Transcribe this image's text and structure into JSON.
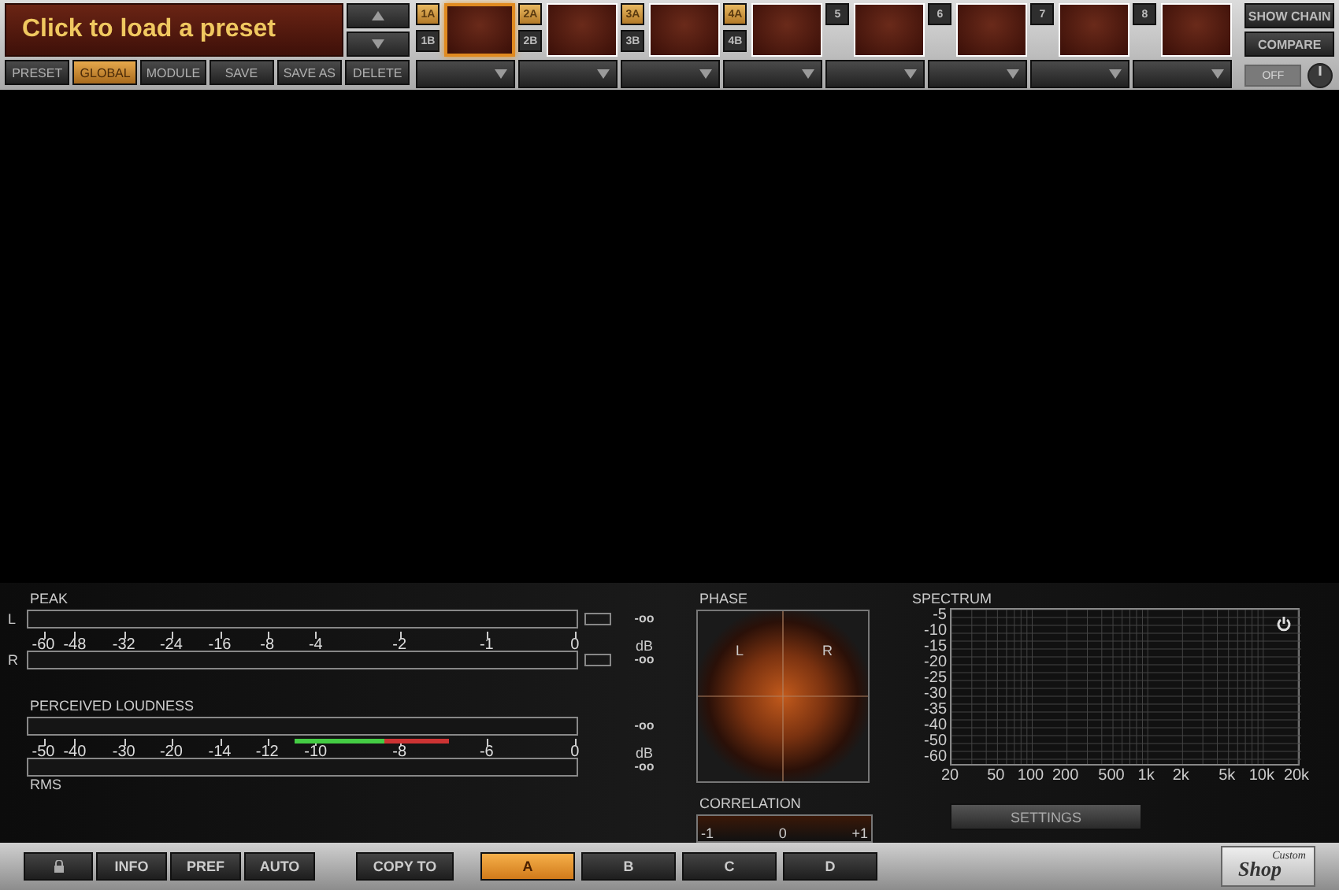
{
  "preset_bar": {
    "display": "Click to load a preset",
    "buttons": [
      {
        "label": "PRESET",
        "selected": false
      },
      {
        "label": "GLOBAL",
        "selected": true
      },
      {
        "label": "MODULE",
        "selected": false
      },
      {
        "label": "SAVE",
        "selected": false
      },
      {
        "label": "SAVE AS",
        "selected": false
      },
      {
        "label": "DELETE",
        "selected": false
      }
    ]
  },
  "slots": [
    {
      "active": true,
      "tabs": [
        {
          "label": "1A",
          "selected": true
        },
        {
          "label": "1B",
          "selected": false
        }
      ]
    },
    {
      "active": false,
      "tabs": [
        {
          "label": "2A",
          "selected": true
        },
        {
          "label": "2B",
          "selected": false
        }
      ]
    },
    {
      "active": false,
      "tabs": [
        {
          "label": "3A",
          "selected": true
        },
        {
          "label": "3B",
          "selected": false
        }
      ]
    },
    {
      "active": false,
      "tabs": [
        {
          "label": "4A",
          "selected": true
        },
        {
          "label": "4B",
          "selected": false
        }
      ]
    },
    {
      "active": false,
      "tabs": [
        {
          "label": "5",
          "selected": false
        }
      ]
    },
    {
      "active": false,
      "tabs": [
        {
          "label": "6",
          "selected": false
        }
      ]
    },
    {
      "active": false,
      "tabs": [
        {
          "label": "7",
          "selected": false
        }
      ]
    },
    {
      "active": false,
      "tabs": [
        {
          "label": "8",
          "selected": false
        }
      ]
    }
  ],
  "right_buttons": [
    "SHOW CHAIN",
    "COMPARE"
  ],
  "bypass": {
    "label": "OFF"
  },
  "peak": {
    "title": "PEAK",
    "channels": [
      {
        "name": "L",
        "reading": "-oo"
      },
      {
        "name": "R",
        "reading": "-oo"
      }
    ],
    "scale": [
      "-60",
      "-48",
      "-32",
      "-24",
      "-16",
      "-8",
      "-4",
      "-2",
      "-1",
      "0"
    ],
    "unit": "dB"
  },
  "loudness": {
    "title": "PERCEIVED LOUDNESS",
    "reading": "-oo",
    "scale": [
      "-50",
      "-40",
      "-30",
      "-20",
      "-14",
      "-12",
      "-10",
      "-8",
      "-6",
      "0"
    ],
    "unit": "dB",
    "rms_reading": "-oo",
    "rms_label": "RMS"
  },
  "phase": {
    "title": "PHASE",
    "left": "L",
    "right": "R"
  },
  "correlation": {
    "title": "CORRELATION",
    "labels": [
      "-1",
      "0",
      "+1"
    ]
  },
  "spectrum": {
    "title": "SPECTRUM",
    "y_labels": [
      "-5",
      "-10",
      "-15",
      "-20",
      "-25",
      "-30",
      "-35",
      "-40",
      "-50",
      "-60"
    ],
    "x_labels": [
      "20",
      "50",
      "100",
      "200",
      "500",
      "1k",
      "2k",
      "5k",
      "10k",
      "20k"
    ],
    "button": "SETTINGS"
  },
  "bottom_bar": {
    "tools": [
      "INFO",
      "PREF",
      "AUTO"
    ],
    "copy_to": "COPY TO",
    "snapshots": [
      {
        "label": "A",
        "selected": true
      },
      {
        "label": "B",
        "selected": false
      },
      {
        "label": "C",
        "selected": false
      },
      {
        "label": "D",
        "selected": false
      }
    ]
  },
  "logo": {
    "line1": "Custom",
    "line2": "Shop"
  }
}
